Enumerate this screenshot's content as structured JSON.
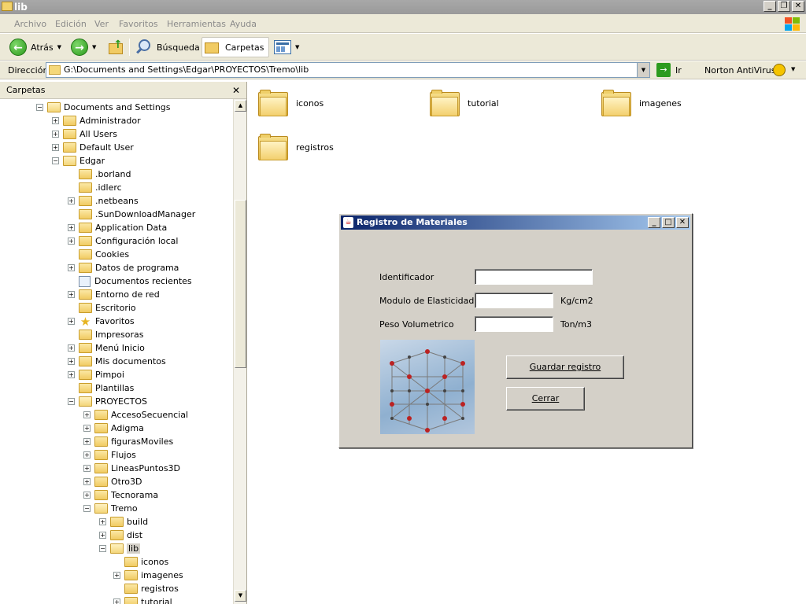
{
  "window": {
    "title": "lib",
    "controls": {
      "minimize": "_",
      "restore": "❐",
      "close": "✕"
    }
  },
  "menu": [
    "Archivo",
    "Edición",
    "Ver",
    "Favoritos",
    "Herramientas",
    "Ayuda"
  ],
  "toolbar": {
    "back_label": "Atrás",
    "search_label": "Búsqueda",
    "folders_label": "Carpetas"
  },
  "address": {
    "label": "Dirección",
    "value": "G:\\Documents and Settings\\Edgar\\PROYECTOS\\Tremo\\lib",
    "go_label": "Ir",
    "norton_label": "Norton AntiVirus"
  },
  "folders_pane": {
    "title": "Carpetas",
    "close": "✕",
    "tree": [
      {
        "label": "Documents and Settings",
        "expander": "−"
      },
      {
        "label": "Administrador",
        "expander": "+"
      },
      {
        "label": "All Users",
        "expander": "+"
      },
      {
        "label": "Default User",
        "expander": "+"
      },
      {
        "label": "Edgar",
        "expander": "−"
      },
      {
        "label": ".borland",
        "expander": ""
      },
      {
        "label": ".idlerc",
        "expander": ""
      },
      {
        "label": ".netbeans",
        "expander": "+"
      },
      {
        "label": ".SunDownloadManager",
        "expander": ""
      },
      {
        "label": "Application Data",
        "expander": "+"
      },
      {
        "label": "Configuración local",
        "expander": "+"
      },
      {
        "label": "Cookies",
        "expander": ""
      },
      {
        "label": "Datos de programa",
        "expander": "+"
      },
      {
        "label": "Documentos recientes",
        "expander": ""
      },
      {
        "label": "Entorno de red",
        "expander": "+"
      },
      {
        "label": "Escritorio",
        "expander": ""
      },
      {
        "label": "Favoritos",
        "expander": "+"
      },
      {
        "label": "Impresoras",
        "expander": ""
      },
      {
        "label": "Menú Inicio",
        "expander": "+"
      },
      {
        "label": "Mis documentos",
        "expander": "+"
      },
      {
        "label": "Pimpoi",
        "expander": "+"
      },
      {
        "label": "Plantillas",
        "expander": ""
      },
      {
        "label": "PROYECTOS",
        "expander": "−"
      },
      {
        "label": "AccesoSecuencial",
        "expander": "+"
      },
      {
        "label": "Adigma",
        "expander": "+"
      },
      {
        "label": "figurasMoviles",
        "expander": "+"
      },
      {
        "label": "Flujos",
        "expander": "+"
      },
      {
        "label": "LineasPuntos3D",
        "expander": "+"
      },
      {
        "label": "Otro3D",
        "expander": "+"
      },
      {
        "label": "Tecnorama",
        "expander": "+"
      },
      {
        "label": "Tremo",
        "expander": "−"
      },
      {
        "label": "build",
        "expander": "+"
      },
      {
        "label": "dist",
        "expander": "+"
      },
      {
        "label": "lib",
        "expander": "−"
      },
      {
        "label": "iconos",
        "expander": ""
      },
      {
        "label": "imagenes",
        "expander": "+"
      },
      {
        "label": "registros",
        "expander": ""
      },
      {
        "label": "tutorial",
        "expander": "+"
      }
    ]
  },
  "content": {
    "items": [
      "iconos",
      "tutorial",
      "imagenes",
      "registros"
    ]
  },
  "dialog": {
    "title": "Registro de Materiales",
    "fields": [
      {
        "label": "Identificador",
        "value": "",
        "unit": ""
      },
      {
        "label": "Modulo de Elasticidad",
        "value": "",
        "unit": "Kg/cm2"
      },
      {
        "label": "Peso Volumetrico",
        "value": "",
        "unit": "Ton/m3"
      }
    ],
    "save_button": "Guardar registro",
    "close_button": "Cerrar"
  }
}
